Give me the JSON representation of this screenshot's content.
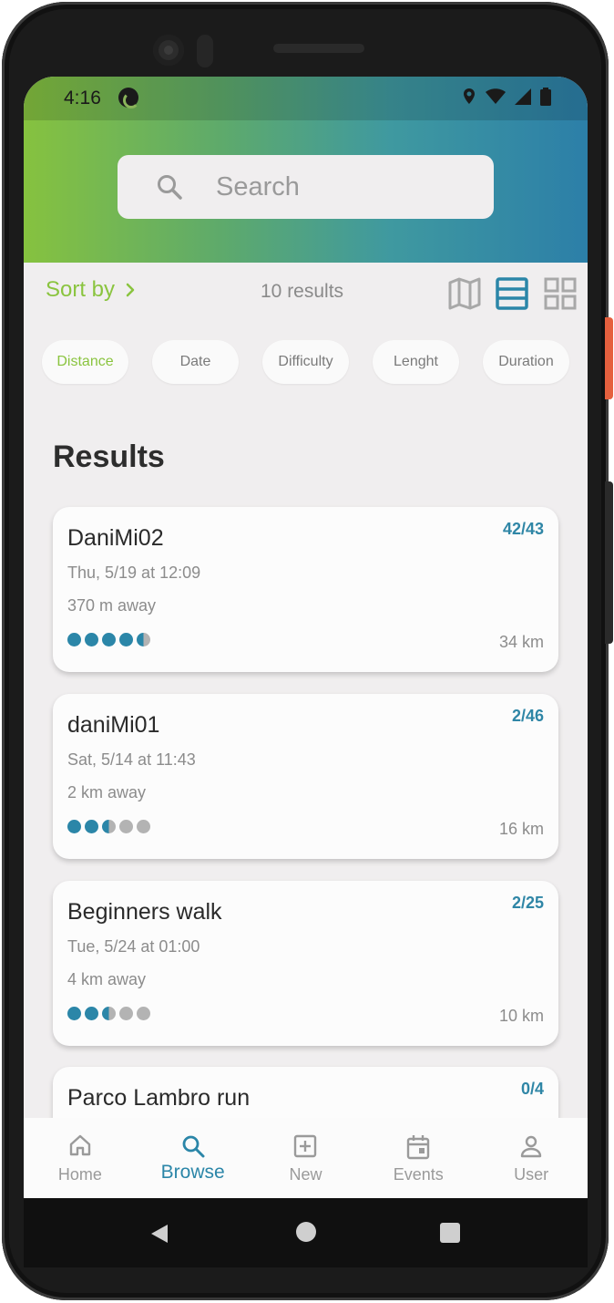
{
  "status_bar": {
    "time": "4:16"
  },
  "search": {
    "placeholder": "Search"
  },
  "toolbar": {
    "sort_label": "Sort by",
    "results_count": "10 results"
  },
  "filters": [
    {
      "label": "Distance",
      "active": true
    },
    {
      "label": "Date",
      "active": false
    },
    {
      "label": "Difficulty",
      "active": false
    },
    {
      "label": "Lenght",
      "active": false
    },
    {
      "label": "Duration",
      "active": false
    }
  ],
  "results_heading": "Results",
  "cards": [
    {
      "name": "DaniMi02",
      "date": "Thu, 5/19 at 12:09",
      "distance": "370 m away",
      "participants": "42/43",
      "length": "34 km",
      "difficulty": 4.5
    },
    {
      "name": "daniMi01",
      "date": "Sat, 5/14 at 11:43",
      "distance": "2 km away",
      "participants": "2/46",
      "length": "16 km",
      "difficulty": 2.5
    },
    {
      "name": "Beginners walk",
      "date": "Tue, 5/24 at 01:00",
      "distance": "4 km away",
      "participants": "2/25",
      "length": "10 km",
      "difficulty": 2.5
    },
    {
      "name": "Parco Lambro run",
      "date": "",
      "distance": "",
      "participants": "0/4",
      "length": "",
      "difficulty": null
    }
  ],
  "nav": [
    {
      "label": "Home",
      "icon": "home-icon",
      "active": false
    },
    {
      "label": "Browse",
      "icon": "search-icon",
      "active": true
    },
    {
      "label": "New",
      "icon": "plus-square-icon",
      "active": false
    },
    {
      "label": "Events",
      "icon": "calendar-icon",
      "active": false
    },
    {
      "label": "User",
      "icon": "user-icon",
      "active": false
    }
  ],
  "colors": {
    "accent_green": "#8ac43f",
    "accent_blue": "#2b86a8",
    "background": "#f0eeef"
  }
}
